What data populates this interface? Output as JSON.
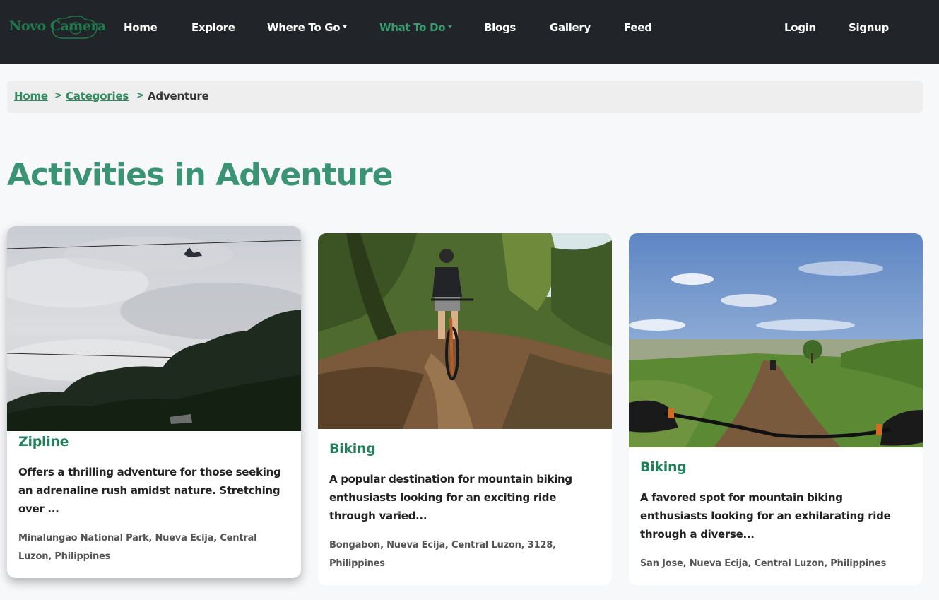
{
  "brand": {
    "name": "Novo Camera",
    "accent_color": "#1f7a4d"
  },
  "nav": {
    "items": [
      {
        "label": "Home",
        "dropdown": false,
        "active": false
      },
      {
        "label": "Explore",
        "dropdown": false,
        "active": false
      },
      {
        "label": "Where To Go",
        "dropdown": true,
        "active": false
      },
      {
        "label": "What To Do",
        "dropdown": true,
        "active": true
      },
      {
        "label": "Blogs",
        "dropdown": false,
        "active": false
      },
      {
        "label": "Gallery",
        "dropdown": false,
        "active": false
      },
      {
        "label": "Feed",
        "dropdown": false,
        "active": false
      }
    ],
    "login": "Login",
    "signup": "Signup"
  },
  "breadcrumb": {
    "items": [
      "Home",
      "Categories",
      "Adventure"
    ],
    "separator": ">"
  },
  "page": {
    "title": "Activities in Adventure",
    "title_color": "#3a9372"
  },
  "cards": [
    {
      "image": "zipline-photo",
      "title": "Zipline",
      "description": "Offers a thrilling adventure for those seeking an adrenaline rush amidst nature. Stretching over ...",
      "location": "Minalungao National Park, Nueva Ecija, Central Luzon, Philippines"
    },
    {
      "image": "forest-biking-photo",
      "title": "Biking",
      "description": "A popular destination for mountain biking enthusiasts looking for an exciting ride through varied...",
      "location": "Bongabon, Nueva Ecija, Central Luzon, 3128, Philippines"
    },
    {
      "image": "hill-biking-photo",
      "title": "Biking",
      "description": "A favored spot for mountain biking enthusiasts looking for an exhilarating ride through a diverse...",
      "location": "San Jose, Nueva Ecija, Central Luzon, Philippines"
    }
  ]
}
